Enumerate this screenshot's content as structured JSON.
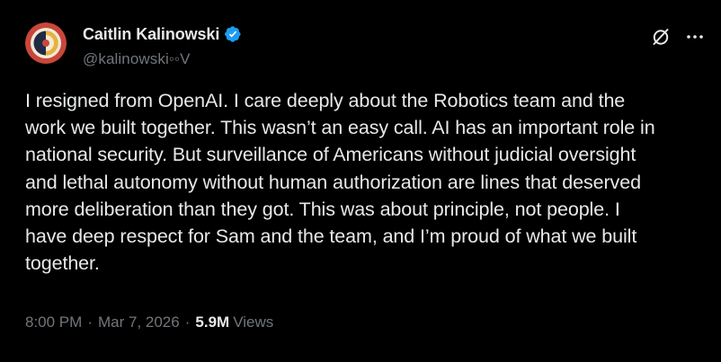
{
  "author": {
    "display_name": "Caitlin Kalinowski",
    "handle": "@kalinowski◦◦V",
    "verified": true
  },
  "tweet": {
    "text": "I resigned from OpenAI. I care deeply about the Robotics team and the\nwork we built together. This wasn’t an easy call. AI has an important role in\nnational security. But surveillance of Americans without judicial oversight\nand lethal autonomy without human authorization are lines that deserved\nmore deliberation than they got. This was about principle, not people. I\nhave deep respect for Sam and the team, and I’m proud of what we built\ntogether."
  },
  "meta": {
    "time": "8:00 PM",
    "separator": "·",
    "date": "Mar 7, 2026",
    "views_count": "5.9M",
    "views_label": "Views"
  },
  "icons": {
    "grok": "grok-icon",
    "more": "more-icon",
    "verified": "verified-badge-icon"
  },
  "colors": {
    "background": "#000000",
    "text_primary": "#e7e9ea",
    "text_secondary": "#71767b",
    "verified": "#1d9bf0"
  }
}
